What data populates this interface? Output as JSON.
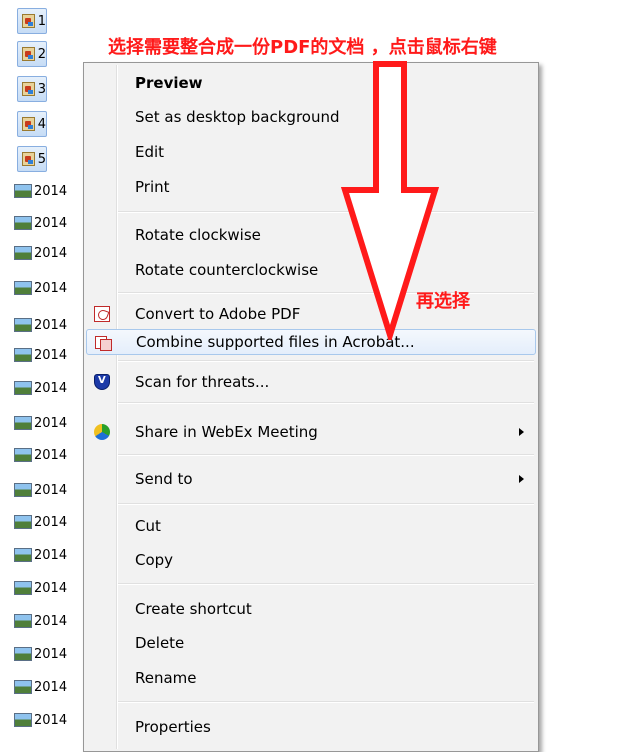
{
  "top_text": "",
  "annotations": {
    "instruction": "选择需要整合成一份PDF的文档 ，点击鼠标右键",
    "then_select": "再选择"
  },
  "files": {
    "selected": [
      {
        "name": "1",
        "icon": "jpg-file-icon"
      },
      {
        "name": "2",
        "icon": "jpg-file-icon"
      },
      {
        "name": "3",
        "icon": "jpg-file-icon"
      },
      {
        "name": "4",
        "icon": "jpg-file-icon"
      },
      {
        "name": "5",
        "icon": "jpg-file-icon"
      }
    ],
    "others": [
      "2014",
      "2014",
      "2014",
      "2014",
      "2014",
      "2014",
      "2014",
      "2014",
      "2014",
      "2014",
      "2014",
      "2014",
      "2014",
      "2014",
      "2014",
      "2014",
      "2014",
      "2014",
      "2014"
    ]
  },
  "menu": {
    "preview": "Preview",
    "set_desktop_bg": "Set as desktop background",
    "edit": "Edit",
    "print": "Print",
    "rotate_cw": "Rotate clockwise",
    "rotate_ccw": "Rotate counterclockwise",
    "convert_pdf": "Convert to Adobe PDF",
    "combine": "Combine supported files in Acrobat...",
    "scan": "Scan for threats...",
    "webex": "Share in WebEx Meeting",
    "send_to": "Send to",
    "cut": "Cut",
    "copy": "Copy",
    "create_shortcut": "Create shortcut",
    "delete": "Delete",
    "rename": "Rename",
    "properties": "Properties"
  },
  "colors": {
    "annotation_red": "#ff1a1a",
    "menu_bg": "#f2f2f2",
    "highlight_border": "#a8c8ec"
  }
}
